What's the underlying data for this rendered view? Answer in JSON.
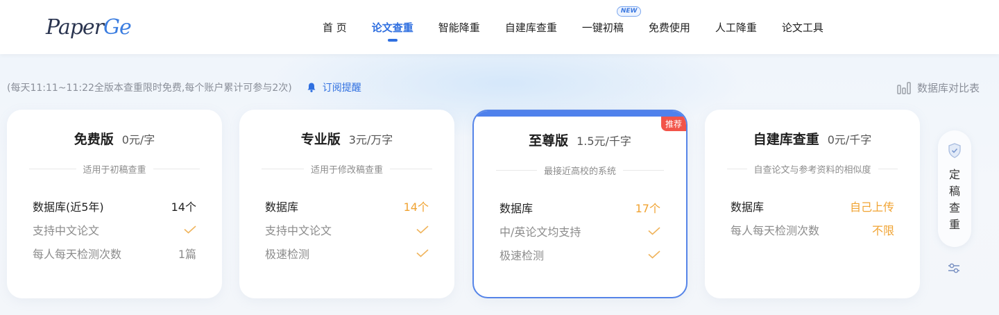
{
  "logo": {
    "text_main": "Paper",
    "text_accent": "Ge"
  },
  "nav": [
    {
      "label": "首 页",
      "name": "nav-home",
      "active": false
    },
    {
      "label": "论文查重",
      "name": "nav-plagiarism-check",
      "active": true
    },
    {
      "label": "智能降重",
      "name": "nav-smart-rewrite",
      "active": false
    },
    {
      "label": "自建库查重",
      "name": "nav-custom-db-check",
      "active": false
    },
    {
      "label": "一键初稿",
      "name": "nav-one-click-draft",
      "active": false,
      "badge": "NEW"
    },
    {
      "label": "免费使用",
      "name": "nav-free-use",
      "active": false
    },
    {
      "label": "人工降重",
      "name": "nav-manual-rewrite",
      "active": false
    },
    {
      "label": "论文工具",
      "name": "nav-paper-tools",
      "active": false
    }
  ],
  "promo": {
    "text": "(每天11:11~11:22全版本查重限时免费,每个账户累计可参与2次)",
    "subscribe_label": "订阅提醒"
  },
  "compare_label": "数据库对比表",
  "cards": [
    {
      "title": "免费版",
      "price": "0元/字",
      "subtitle": "适用于初稿查重",
      "rows": [
        {
          "key": "数据库(近5年)",
          "value": "14个",
          "key_style": "",
          "value_style": ""
        },
        {
          "key": "支持中文论文",
          "value": "",
          "check": true,
          "key_style": "muted"
        },
        {
          "key": "每人每天检测次数",
          "value": "1篇",
          "key_style": "muted",
          "value_style": "muted"
        }
      ]
    },
    {
      "title": "专业版",
      "price": "3元/万字",
      "subtitle": "适用于修改稿查重",
      "rows": [
        {
          "key": "数据库",
          "value": "14个",
          "key_style": "",
          "value_style": "orange"
        },
        {
          "key": "支持中文论文",
          "value": "",
          "check": true,
          "key_style": "muted"
        },
        {
          "key": "极速检测",
          "value": "",
          "check": true,
          "key_style": "muted"
        }
      ]
    },
    {
      "title": "至尊版",
      "price": "1.5元/千字",
      "subtitle": "最接近高校的系统",
      "badge": "推荐",
      "rows": [
        {
          "key": "数据库",
          "value": "17个",
          "key_style": "",
          "value_style": "orange"
        },
        {
          "key": "中/英论文均支持",
          "value": "",
          "check": true,
          "key_style": "muted"
        },
        {
          "key": "极速检测",
          "value": "",
          "check": true,
          "key_style": "muted"
        }
      ]
    },
    {
      "title": "自建库查重",
      "price": "0元/千字",
      "subtitle": "自查论文与参考资料的相似度",
      "rows": [
        {
          "key": "数据库",
          "value": "自己上传",
          "key_style": "",
          "value_style": "orange"
        },
        {
          "key": "每人每天检测次数",
          "value": "不限",
          "key_style": "muted",
          "value_style": "orange"
        }
      ]
    }
  ],
  "side": {
    "label": "定稿查重"
  },
  "colors": {
    "accent": "#2f6fe0",
    "orange": "#f0a332",
    "badge_red": "#f25449"
  }
}
